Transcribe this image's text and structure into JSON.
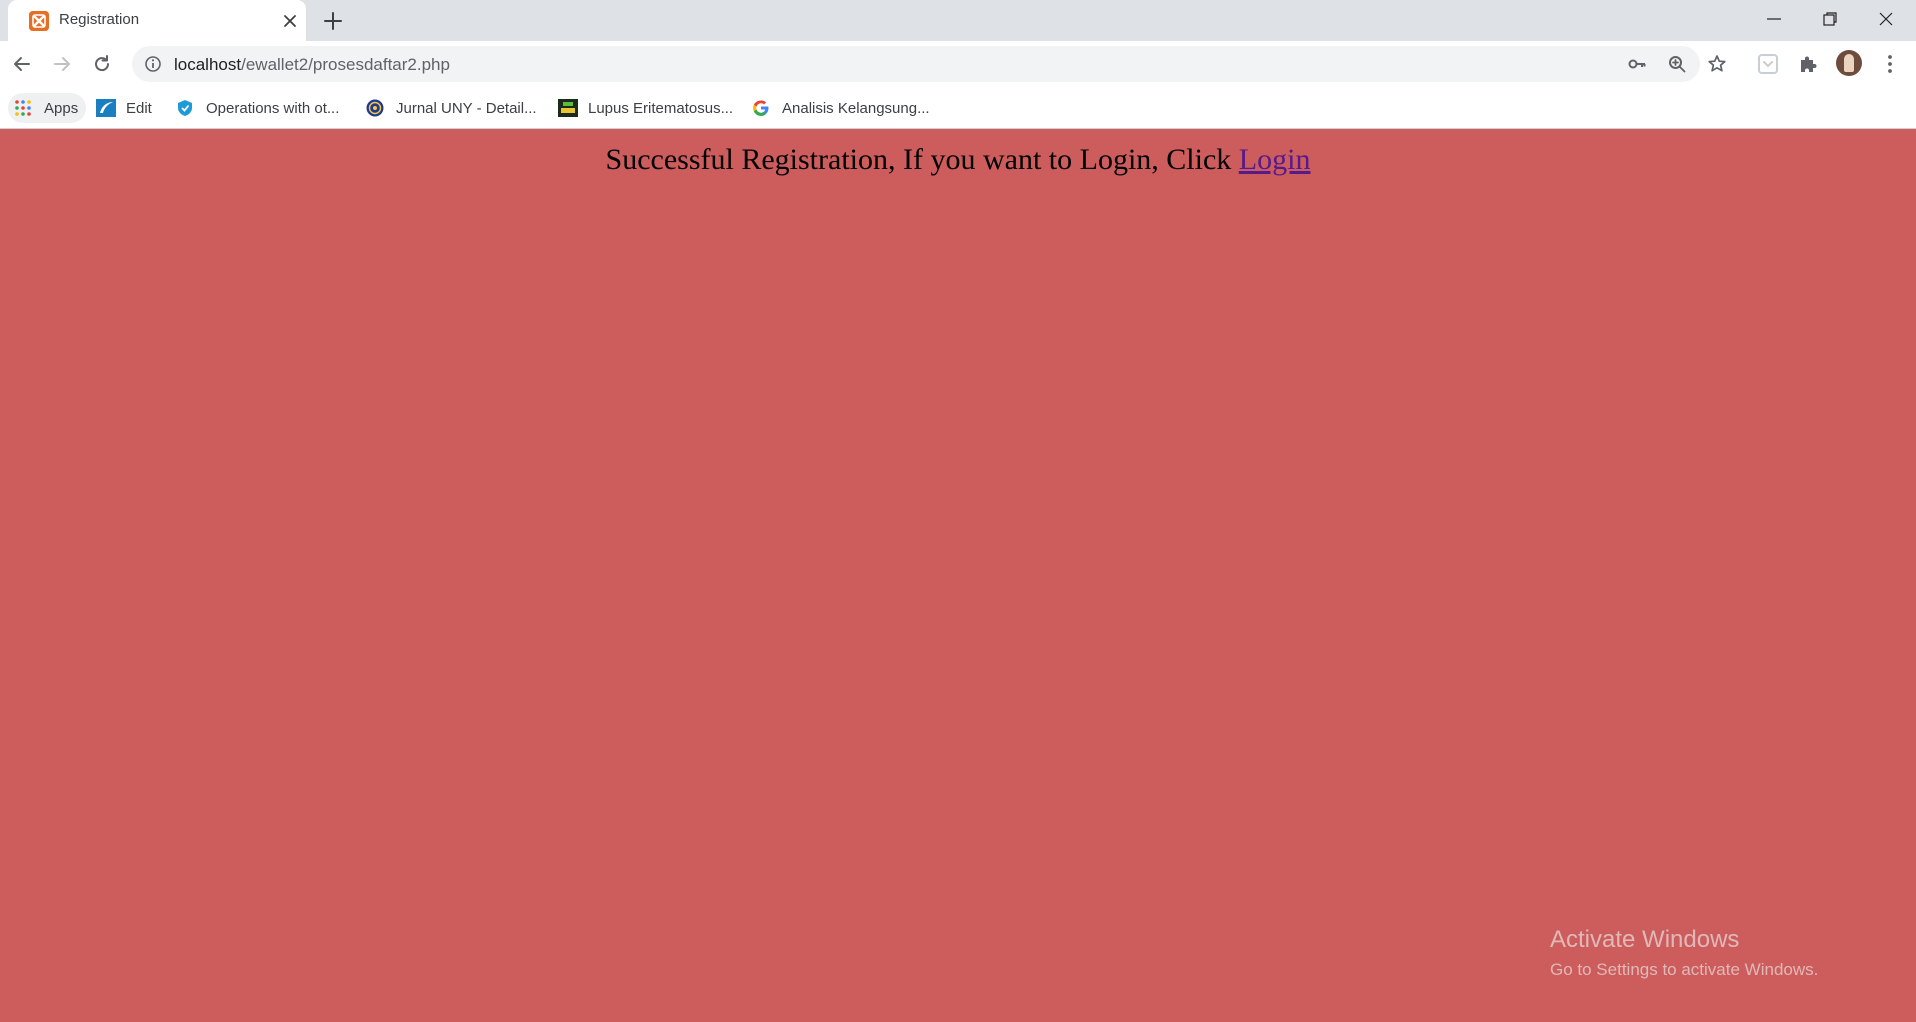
{
  "browser": {
    "tab": {
      "title": "Registration",
      "favicon": "xampp-icon"
    },
    "address_bar": {
      "host": "localhost",
      "path": "/ewallet2/prosesdaftar2.php"
    },
    "bookmarks": [
      {
        "label": "Apps",
        "icon": "apps-grid-icon"
      },
      {
        "label": "Edit",
        "icon": "edit-site-icon"
      },
      {
        "label": "Operations with ot...",
        "icon": "shield-icon"
      },
      {
        "label": "Jurnal UNY - Detail...",
        "icon": "uny-seal-icon"
      },
      {
        "label": "Lupus Eritematosus...",
        "icon": "jka-icon"
      },
      {
        "label": "Analisis Kelangsung...",
        "icon": "google-icon"
      }
    ]
  },
  "page": {
    "background_color": "#cd5c5c",
    "message": "Successful Registration, If you want to Login, Click",
    "login_link": "Login"
  },
  "watermark": {
    "title": "Activate Windows",
    "subtitle": "Go to Settings to activate Windows."
  }
}
